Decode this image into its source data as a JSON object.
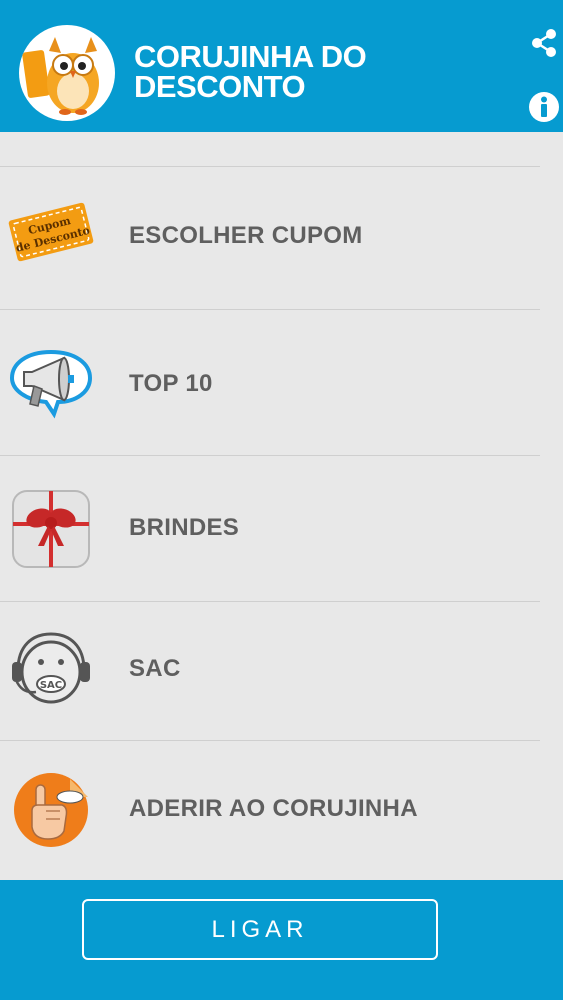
{
  "header": {
    "title_line1": "CORUJINHA DO",
    "title_line2": "DESCONTO",
    "logo_icon": "owl-logo-icon",
    "share_icon": "share-icon",
    "info_icon": "info-icon"
  },
  "menu": {
    "items": [
      {
        "label": "ESCOLHER CUPOM",
        "icon": "coupon-icon",
        "icon_text": "Cupom de Desconto"
      },
      {
        "label": "TOP 10",
        "icon": "megaphone-icon"
      },
      {
        "label": "BRINDES",
        "icon": "gift-icon"
      },
      {
        "label": "SAC",
        "icon": "support-headset-icon",
        "icon_text": "SAC"
      },
      {
        "label": "ADERIR AO CORUJINHA",
        "icon": "hand-icon"
      }
    ]
  },
  "footer": {
    "call_label": "LIGAR"
  },
  "colors": {
    "primary": "#069bd0",
    "background": "#e8e8e8",
    "text": "#5f5f5f"
  }
}
